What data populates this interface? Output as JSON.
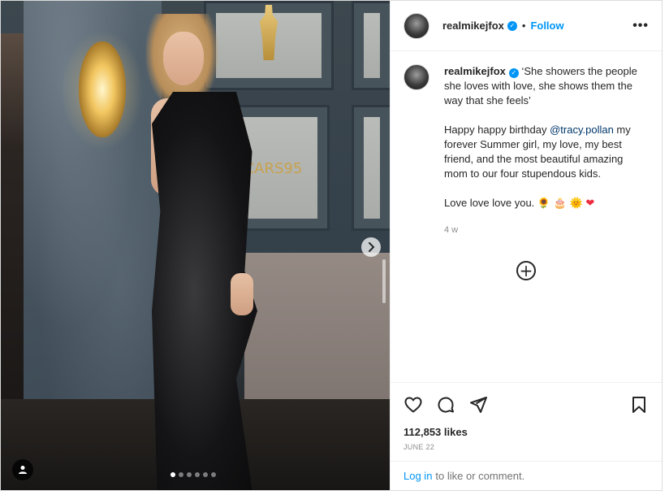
{
  "post": {
    "carousel": {
      "slide_count": 6,
      "active_index": 0,
      "backdrop_text": "OSCARS95"
    },
    "author": {
      "username": "realmikejfox",
      "verified": true,
      "separator": "•",
      "follow_label": "Follow",
      "more_icon": "more-horizontal-icon",
      "more_label": "•••"
    },
    "caption": {
      "username": "realmikejfox",
      "line1": "‘She showers the people she loves with love, she shows them the way that she feels’",
      "line2_prefix": "Happy happy birthday ",
      "mention": "@tracy.pollan",
      "line2_suffix": " my forever Summer girl, my love, my best friend, and the most beautiful amazing mom to our four stupendous kids.",
      "line3": "Love love love you.",
      "emojis": [
        "🌻",
        "🎂",
        "🌞",
        "❤"
      ],
      "time": "4 w"
    },
    "load_more_label": "+",
    "stats": {
      "likes": "112,853 likes",
      "date": "JUNE 22"
    },
    "login": {
      "link": "Log in",
      "text": "to like or comment."
    },
    "colors": {
      "accent": "#0095f6",
      "mention": "#00376b",
      "muted": "#8e8e8e",
      "heart": "#ed2d3d"
    },
    "icons": {
      "like": "heart-icon",
      "comment": "comment-icon",
      "share": "send-icon",
      "save": "bookmark-icon",
      "next": "chevron-right-icon",
      "tags": "user-tag-icon"
    }
  }
}
